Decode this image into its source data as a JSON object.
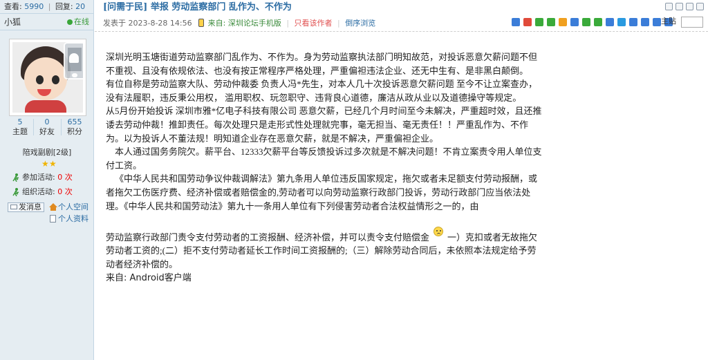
{
  "stats_bar": {
    "views_label": "查看:",
    "views": "5990",
    "replies_label": "回复:",
    "replies": "20"
  },
  "user": {
    "name": "小狐",
    "online": "在线",
    "topics": "5",
    "topics_label": "主题",
    "friends": "0",
    "friends_label": "好友",
    "points": "655",
    "points_label": "积分",
    "rank": "陪戏副剧[2级]",
    "activity1_label": "参加活动:",
    "activity1_value": "0 次",
    "activity2_label": "组织活动:",
    "activity2_value": "0 次",
    "message_btn": "发消息",
    "space_link": "个人空间",
    "profile_link": "个人资料"
  },
  "post": {
    "title": "[问需于民] 举报 劳动监察部门 乱作为、不作为",
    "posted_label": "发表于",
    "posted_time": "2023-8-28 14:56",
    "source": "来自: 深圳论坛手机版",
    "author_only": "只看该作者",
    "reverse": "倒序浏览",
    "font_label": "主贴",
    "share_colors": [
      "#3b7dd8",
      "#e04a3a",
      "#3aaa3a",
      "#3aaa3a",
      "#f0a020",
      "#3b7dd8",
      "#3aaa3a",
      "#3aaa3a",
      "#3b7dd8",
      "#2a9ae0",
      "#3b7dd8",
      "#3b7dd8",
      "#3b7dd8",
      "#3b7dd8"
    ],
    "paragraphs": [
      "深圳光明玉塘街道劳动监察部门乱作为、不作为。身为劳动监察执法部门明知故范，对投诉恶意欠薪问题不但不重视、且没有依规依法、也没有按正常程序严格处理，严重偏袒违法企业、还无中生有、是非黑白颠倒。",
      "有位自称是劳动监察大队、劳动仲裁委 负责人冯*先生，对本人几十次投诉恶意欠薪问题 至今不让立案查办，没有法履职，违反秉公用权，  滥用职权、玩忽职守、违背良心道德，廉洁从政从业以及道德操守等规定。",
      "从5月份开始投诉 深圳市雅*亿电子科技有限公司 恶意欠薪，已经几个月时间至今未解决，严重超时效，且还推诿去劳动仲裁！推卸责任。每次处理只是走形式性处理就完事，毫无担当、毫无责任！！严重乱作为、不作为。以为投诉人不董法规！明知道企业存在恶意欠薪，就是不解决，严重偏袒企业。",
      "    本人通过国务务院欠。薪平台、12333欠薪平台等反馈投诉过多次就是不解决问题！不肯立案责令用人单位支付工资。",
      "    《中华人民共和国劳动争议仲裁调解法》第九条用人单位违反国家规定，拖欠或者未足额支付劳动报酬，或者拖欠工伤医疗费、经济补偿或者赔偿金的,劳动者可以向劳动监察行政部门投诉，劳动行政部门应当依法处理。《中华人民共和国劳动法》第九十一条用人单位有下列侵害劳动者合法权益情形之一的，由",
      "劳动监察行政部门责令支付劳动者的工资报酬、经济补偿，并可以责令支付赔偿金",
      "一）克扣或者无故拖欠劳动者工资的;(二）拒不支付劳动者延长工作时间工资报酬的;（三）解除劳动合同后，未依照本法规定给予劳动者经济补偿的。",
      "来自: Android客户端"
    ]
  }
}
